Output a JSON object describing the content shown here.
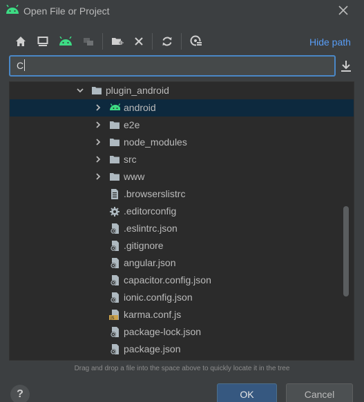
{
  "window": {
    "title": "Open File or Project"
  },
  "toolbar": {
    "buttons": [
      "home-icon",
      "desktop-icon",
      "android-icon",
      "module-icon",
      "new-folder-icon",
      "delete-icon",
      "refresh-icon",
      "show-hidden-icon"
    ],
    "hide_path_label": "Hide path"
  },
  "path": {
    "value": "C"
  },
  "tree": {
    "rows": [
      {
        "label": "plugin_android",
        "kind": "folder",
        "expanded": true
      },
      {
        "label": "android",
        "kind": "android-folder",
        "selected": true
      },
      {
        "label": "e2e",
        "kind": "folder"
      },
      {
        "label": "node_modules",
        "kind": "folder"
      },
      {
        "label": "src",
        "kind": "folder"
      },
      {
        "label": "www",
        "kind": "folder"
      },
      {
        "label": ".browserslistrc",
        "kind": "text-file"
      },
      {
        "label": ".editorconfig",
        "kind": "config-file"
      },
      {
        "label": ".eslintrc.json",
        "kind": "json-file"
      },
      {
        "label": ".gitignore",
        "kind": "json-file"
      },
      {
        "label": "angular.json",
        "kind": "json-file"
      },
      {
        "label": "capacitor.config.json",
        "kind": "json-file"
      },
      {
        "label": "ionic.config.json",
        "kind": "json-file"
      },
      {
        "label": "karma.conf.js",
        "kind": "js-file"
      },
      {
        "label": "package-lock.json",
        "kind": "json-file"
      },
      {
        "label": "package.json",
        "kind": "json-file"
      }
    ]
  },
  "hint": "Drag and drop a file into the space above to quickly locate it in the tree",
  "footer": {
    "help_label": "?",
    "ok_label": "OK",
    "cancel_label": "Cancel"
  },
  "colors": {
    "accent": "#589df6",
    "selection": "#0d293e",
    "android_green": "#3ddc84"
  }
}
